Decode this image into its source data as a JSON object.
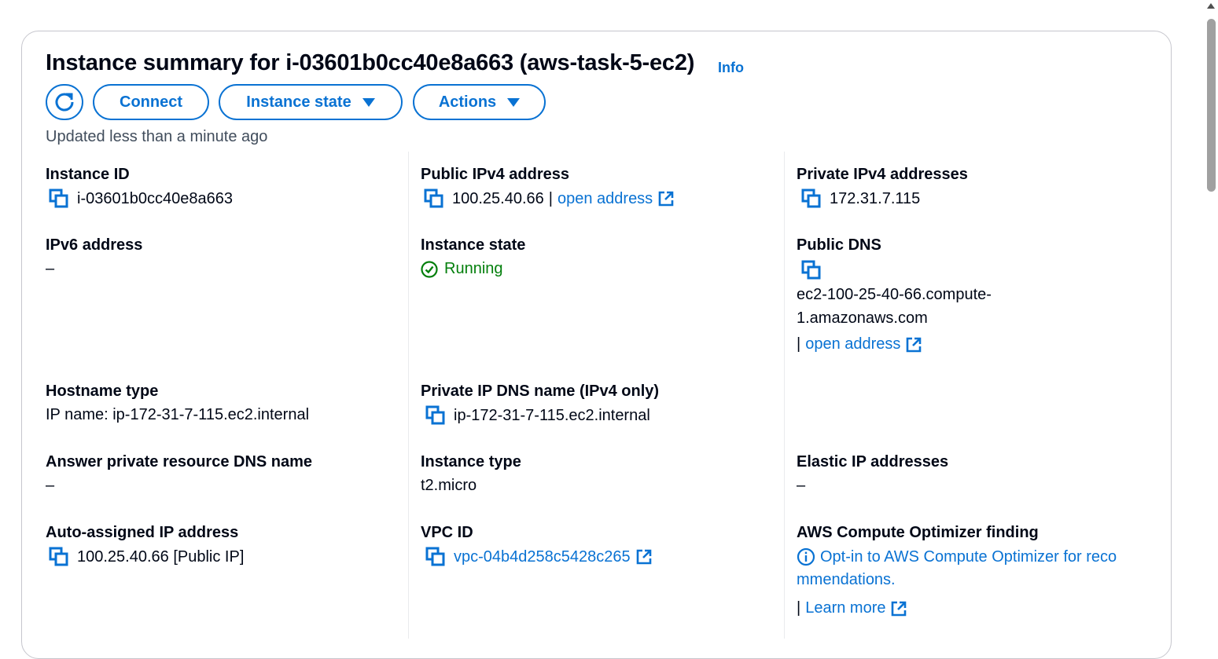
{
  "header": {
    "title": "Instance summary for i-03601b0cc40e8a663 (aws-task-5-ec2)",
    "info": "Info",
    "updated": "Updated less than a minute ago"
  },
  "toolbar": {
    "connect": "Connect",
    "instance_state": "Instance state",
    "actions": "Actions"
  },
  "fields": {
    "instance_id": {
      "label": "Instance ID",
      "value": "i-03601b0cc40e8a663"
    },
    "public_ipv4": {
      "label": "Public IPv4 address",
      "value": "100.25.40.66",
      "sep": "|",
      "link": "open address"
    },
    "private_ipv4": {
      "label": "Private IPv4 addresses",
      "value": "172.31.7.115"
    },
    "ipv6": {
      "label": "IPv6 address",
      "value": "–"
    },
    "instance_state": {
      "label": "Instance state",
      "value": "Running"
    },
    "public_dns": {
      "label": "Public DNS",
      "value_line1": "ec2-100-25-40-66.compute-",
      "value_line2": "1.amazonaws.com",
      "sep": "|",
      "link": "open address"
    },
    "hostname_type": {
      "label": "Hostname type",
      "value": "IP name: ip-172-31-7-115.ec2.internal"
    },
    "private_ip_dns": {
      "label": "Private IP DNS name (IPv4 only)",
      "value": "ip-172-31-7-115.ec2.internal"
    },
    "answer_private_dns": {
      "label": "Answer private resource DNS name",
      "value": "–"
    },
    "instance_type": {
      "label": "Instance type",
      "value": "t2.micro"
    },
    "elastic_ip": {
      "label": "Elastic IP addresses",
      "value": "–"
    },
    "auto_ip": {
      "label": "Auto-assigned IP address",
      "value": "100.25.40.66 [Public IP]"
    },
    "vpc_id": {
      "label": "VPC ID",
      "value": "vpc-04b4d258c5428c265"
    },
    "compute_optimizer": {
      "label": "AWS Compute Optimizer finding",
      "link_line1": "Opt-in to AWS Compute Optimizer for reco",
      "link_line2": "mmendations.",
      "sep": "|",
      "learn_more": "Learn more"
    }
  },
  "colors": {
    "link": "#0972d3",
    "running": "#037f0c",
    "text": "#000716"
  }
}
